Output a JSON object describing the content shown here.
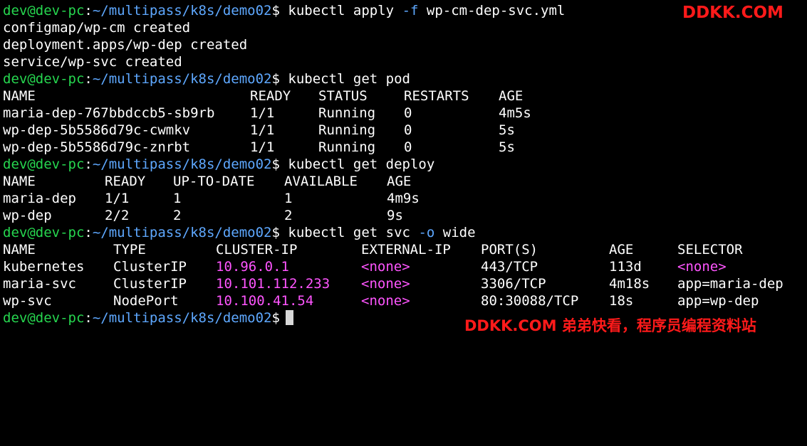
{
  "prompt": {
    "user_host": "dev@dev-pc",
    "separator": ":",
    "path": "~/multipass/k8s/demo02",
    "symbol": "$"
  },
  "commands": {
    "apply": {
      "pre": " kubectl apply ",
      "flag": "-f",
      "post": " wp-cm-dep-svc.yml"
    },
    "get_pod": " kubectl get pod",
    "get_deploy": " kubectl get deploy",
    "get_svc": {
      "pre": " kubectl get svc ",
      "flag": "-o",
      "post": " wide"
    }
  },
  "apply_output": [
    "configmap/wp-cm created",
    "deployment.apps/wp-dep created",
    "service/wp-svc created"
  ],
  "pods": {
    "headers": [
      "NAME",
      "READY",
      "STATUS",
      "RESTARTS",
      "AGE"
    ],
    "rows": [
      [
        "maria-dep-767bbdccb5-sb9rb",
        "1/1",
        "Running",
        "0",
        "4m5s"
      ],
      [
        "wp-dep-5b5586d79c-cwmkv",
        "1/1",
        "Running",
        "0",
        "5s"
      ],
      [
        "wp-dep-5b5586d79c-znrbt",
        "1/1",
        "Running",
        "0",
        "5s"
      ]
    ]
  },
  "deploys": {
    "headers": [
      "NAME",
      "READY",
      "UP-TO-DATE",
      "AVAILABLE",
      "AGE"
    ],
    "rows": [
      [
        "maria-dep",
        "1/1",
        "1",
        "1",
        "4m9s"
      ],
      [
        "wp-dep",
        "2/2",
        "2",
        "2",
        "9s"
      ]
    ]
  },
  "services": {
    "headers": [
      "NAME",
      "TYPE",
      "CLUSTER-IP",
      "EXTERNAL-IP",
      "PORT(S)",
      "AGE",
      "SELECTOR"
    ],
    "rows": [
      [
        "kubernetes",
        "ClusterIP",
        "10.96.0.1",
        "<none>",
        "443/TCP",
        "113d",
        "<none>"
      ],
      [
        "maria-svc",
        "ClusterIP",
        "10.101.112.233",
        "<none>",
        "3306/TCP",
        "4m18s",
        "app=maria-dep"
      ],
      [
        "wp-svc",
        "NodePort",
        "10.100.41.54",
        "<none>",
        "80:30088/TCP",
        "18s",
        "app=wp-dep"
      ]
    ]
  },
  "watermarks": {
    "top": "DDKK.COM",
    "bottom": "DDKK.COM 弟弟快看，程序员编程资料站"
  },
  "colors": {
    "background": "#000000",
    "text": "#ffffff",
    "prompt_user": "#26d64f",
    "prompt_path": "#5ea8ff",
    "flag": "#5ea8ff",
    "ip_highlight": "#ff55ff",
    "watermark": "#ff1a1a",
    "cursor": "#d8d8d8"
  }
}
